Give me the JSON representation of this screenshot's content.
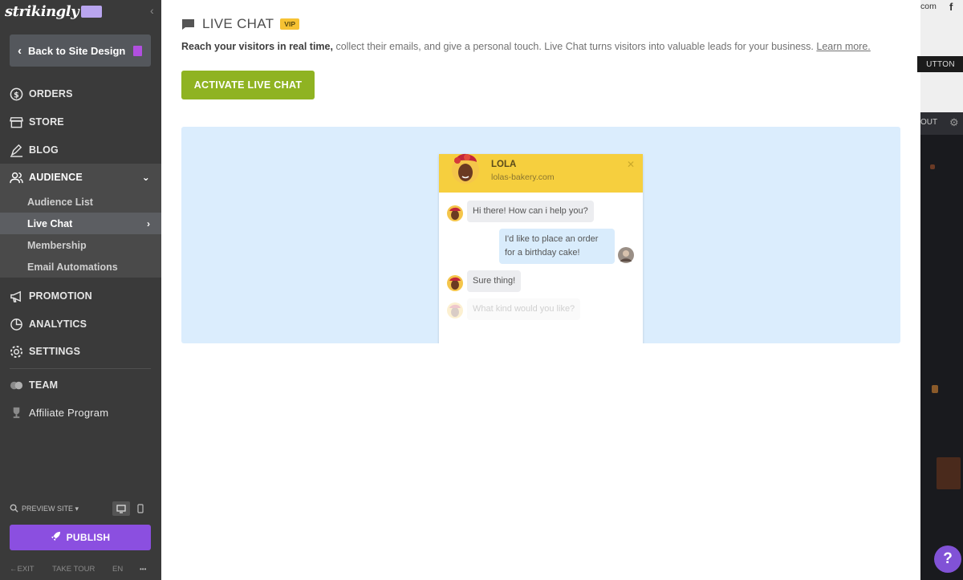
{
  "brand": {
    "logo": "strikingly"
  },
  "sidebar": {
    "back_label": "Back to Site Design",
    "items": [
      {
        "label": "ORDERS",
        "icon": "dollar-circle-icon"
      },
      {
        "label": "STORE",
        "icon": "storefront-icon"
      },
      {
        "label": "BLOG",
        "icon": "pen-icon"
      },
      {
        "label": "AUDIENCE",
        "icon": "people-icon"
      }
    ],
    "audience_subitems": [
      {
        "label": "Audience List"
      },
      {
        "label": "Live Chat"
      },
      {
        "label": "Membership"
      },
      {
        "label": "Email Automations"
      }
    ],
    "items_after": [
      {
        "label": "PROMOTION",
        "icon": "megaphone-icon"
      },
      {
        "label": "ANALYTICS",
        "icon": "pie-chart-icon"
      },
      {
        "label": "SETTINGS",
        "icon": "gear-icon"
      }
    ],
    "team_label": "TEAM",
    "affiliate_label": "Affiliate Program",
    "preview_site_label": "PREVIEW SITE",
    "publish_label": "PUBLISH",
    "footer": {
      "exit": "EXIT",
      "take_tour": "TAKE TOUR",
      "lang": "EN",
      "more": "•••"
    }
  },
  "main": {
    "title": "LIVE CHAT",
    "vip_badge": "VIP",
    "description_bold": "Reach your visitors in real time,",
    "description_rest": " collect their emails, and give a personal touch. Live Chat turns visitors into valuable leads for your business. ",
    "learn_more": "Learn more.",
    "activate_label": "ACTIVATE LIVE CHAT",
    "preview": {
      "agent_name": "LOLA",
      "agent_site": "lolas-bakery.com",
      "messages": [
        {
          "from": "agent",
          "text": "Hi there! How can i help you?"
        },
        {
          "from": "user",
          "text_line1": "I'd like to place an order",
          "text_line2": "for a birthday cake!"
        },
        {
          "from": "agent",
          "text": "Sure thing!"
        },
        {
          "from": "agent",
          "text": "What kind would you like?"
        }
      ]
    }
  },
  "right_panel": {
    "com_text": "com",
    "button_text": "UTTON",
    "out_text": "OUT",
    "help_label": "?"
  },
  "colors": {
    "sidebar_bg": "#3a3a3a",
    "activate_green": "#8fb322",
    "publish_purple": "#8b4fe0",
    "chat_header_yellow": "#f6cf3e",
    "preview_bg": "#dbedfd",
    "vip_yellow": "#f6c233"
  }
}
